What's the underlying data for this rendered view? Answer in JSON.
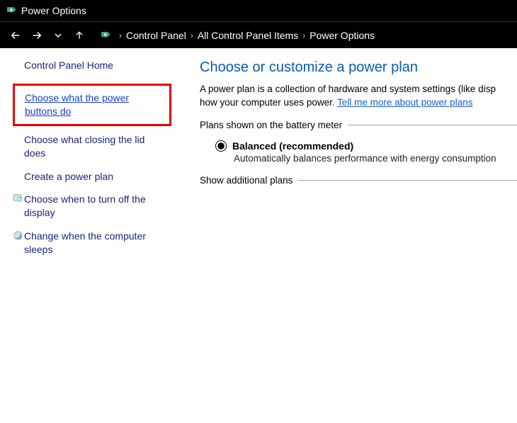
{
  "titlebar": {
    "title": "Power Options"
  },
  "breadcrumb": {
    "items": [
      "Control Panel",
      "All Control Panel Items",
      "Power Options"
    ]
  },
  "sidebar": {
    "heading": "Control Panel Home",
    "links": {
      "power_buttons": "Choose what the power buttons do",
      "closing_lid": "Choose what closing the lid does",
      "create_plan": "Create a power plan",
      "turn_off_display": "Choose when to turn off the display",
      "computer_sleeps": "Change when the computer sleeps"
    }
  },
  "main": {
    "heading": "Choose or customize a power plan",
    "description_part1": "A power plan is a collection of hardware and system settings (like disp",
    "description_part2": "how your computer uses power. ",
    "learn_more_link": "Tell me more about power plans",
    "plans_legend": "Plans shown on the battery meter",
    "plan_balanced_label": "Balanced (recommended)",
    "plan_balanced_desc": "Automatically balances performance with energy consumption",
    "additional_legend": "Show additional plans"
  }
}
